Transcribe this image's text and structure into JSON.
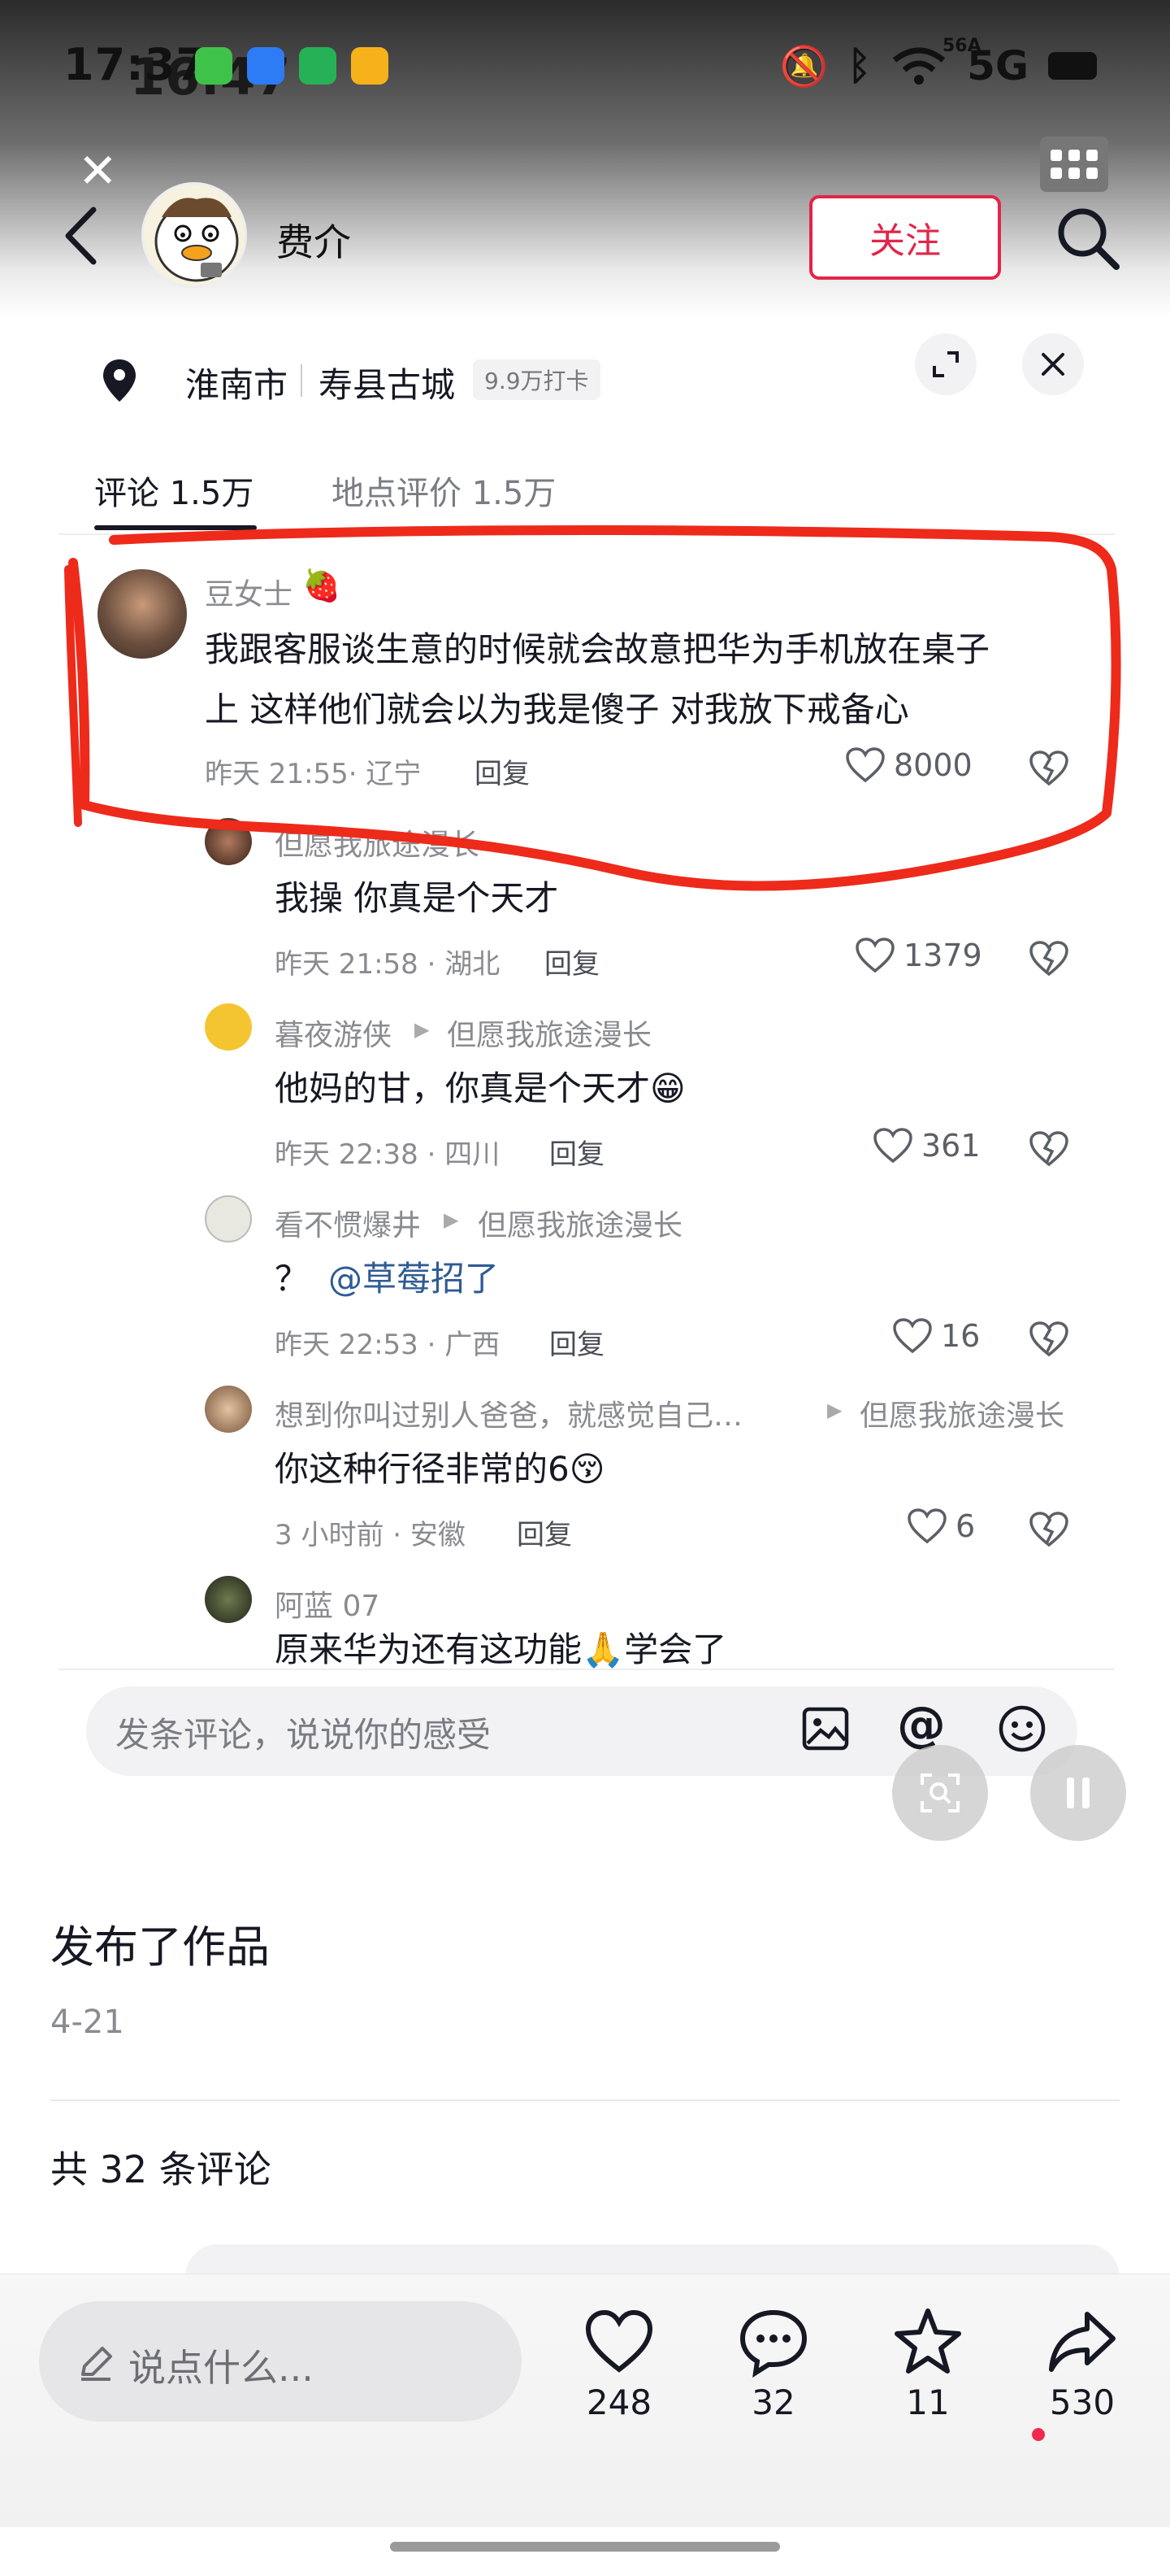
{
  "status_bar": {
    "time": "17:37",
    "time_ghost": "16:47",
    "network": "5G",
    "network_small": "56A"
  },
  "header": {
    "username": "费介",
    "follow_label": "关注"
  },
  "location": {
    "city": "淮南市",
    "place": "寿县古城",
    "checkins": "9.9万打卡"
  },
  "tabs": [
    {
      "label": "评论 1.5万"
    },
    {
      "label": "地点评价 1.5万"
    }
  ],
  "comments": [
    {
      "name": "豆女士",
      "text_line1": "我跟客服谈生意的时候就会故意把华为手机放在桌子",
      "text_line2": "上 这样他们就会以为我是傻子 对我放下戒备心",
      "time_loc": "昨天 21:55· 辽宁",
      "reply_label": "回复",
      "likes": "8000"
    },
    {
      "name": "但愿我旅途漫长",
      "text": "我操 你真是个天才",
      "time_loc": "昨天 21:58 · 湖北",
      "reply_label": "回复",
      "likes": "1379"
    },
    {
      "name": "暮夜游侠",
      "reply_to": "但愿我旅途漫长",
      "text": "他妈的甘，你真是个天才😁",
      "time_loc": "昨天 22:38 · 四川",
      "reply_label": "回复",
      "likes": "361"
    },
    {
      "name": "看不惯爆井",
      "reply_to": "但愿我旅途漫长",
      "text_prefix": "？",
      "mention": "@草莓招了",
      "time_loc": "昨天 22:53 · 广西",
      "reply_label": "回复",
      "likes": "16"
    },
    {
      "name": "想到你叫过别人爸爸，就感觉自己…",
      "reply_to": "但愿我旅途漫长",
      "text": "你这种行径非常的6😚",
      "time_loc": "3 小时前 · 安徽",
      "reply_label": "回复",
      "likes": "6"
    },
    {
      "name": "阿蓝 07",
      "text": "原来华为还有这功能🙏学会了"
    }
  ],
  "comment_input": {
    "placeholder": "发条评论，说说你的感受"
  },
  "post": {
    "title": "发布了作品",
    "date": "4-21",
    "total_comments": "共 32 条评论"
  },
  "bottom_bar": {
    "say_placeholder": "说点什么...",
    "likes": "248",
    "comments": "32",
    "favorites": "11",
    "shares": "530"
  },
  "colors": {
    "accent_red": "#e2254a",
    "annotation_red": "#ee2a1b",
    "mention_blue": "#2f5b93"
  }
}
